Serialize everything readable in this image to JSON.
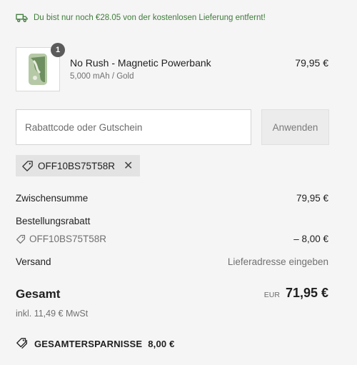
{
  "shipping_banner": {
    "text": "Du bist nur noch €28.05 von der kostenlosen Lieferung entfernt!",
    "icon": "truck-icon",
    "color": "#3f7c3a"
  },
  "product": {
    "quantity": "1",
    "title": "No Rush - Magnetic Powerbank",
    "variant": "5,000 mAh / Gold",
    "price": "79,95 €"
  },
  "discount": {
    "placeholder": "Rabattcode oder Gutschein",
    "apply_label": "Anwenden",
    "applied_code": "OFF10BS75T58R"
  },
  "summary": {
    "subtotal_label": "Zwischensumme",
    "subtotal_value": "79,95 €",
    "order_discount_label": "Bestellungsrabatt",
    "order_discount_code": "OFF10BS75T58R",
    "order_discount_value": "– 8,00 €",
    "shipping_label": "Versand",
    "shipping_value": "Lieferadresse eingeben",
    "total_label": "Gesamt",
    "currency": "EUR",
    "total_value": "71,95 €",
    "tax_note": "inkl. 11,49 € MwSt",
    "savings_label": "GESAMTERSPARNISSE",
    "savings_value": "8,00 €"
  }
}
